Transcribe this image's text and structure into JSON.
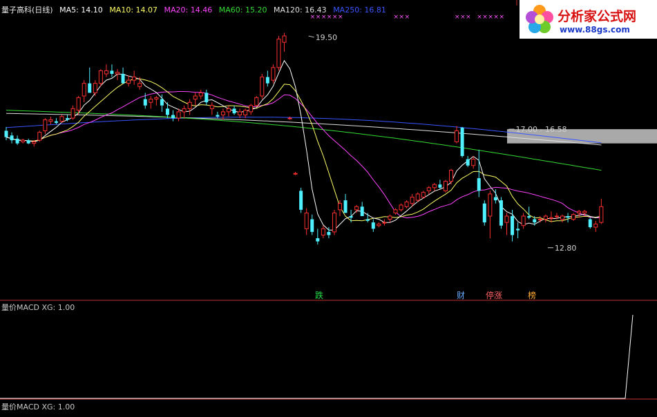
{
  "header": {
    "title": "量子高科(日线)",
    "indicators": [
      {
        "label": "MA5: 14.10",
        "color": "#ffffff"
      },
      {
        "label": "MA10: 14.07",
        "color": "#ffff66"
      },
      {
        "label": "MA20: 14.46",
        "color": "#ff44ff"
      },
      {
        "label": "MA60: 15.20",
        "color": "#33dd33"
      },
      {
        "label": "MA120: 16.43",
        "color": "#e0e0e0"
      },
      {
        "label": "MA250: 16.81",
        "color": "#3a55ff"
      }
    ]
  },
  "sub_panel": {
    "label_top": "量价MACD XG: 1.00",
    "label_bottom": "量价MACD XG: 1.00"
  },
  "logo": {
    "name": "分析家公式网",
    "url": "www.88gs.com"
  },
  "chart_data": {
    "type": "candlestick",
    "price_range": [
      11.9,
      20.2
    ],
    "colors": {
      "up": "#ff3030",
      "down": "#4ff0ff",
      "ma5": "#ffffff",
      "ma10": "#ffff66",
      "ma20": "#ff44ff",
      "ma60": "#33dd33",
      "ma120": "#e0e0e0",
      "ma250": "#3a55ff"
    },
    "annotations": [
      {
        "text": "19.50",
        "price": 19.5
      },
      {
        "text": "17.00 - 16.58",
        "price": 16.55
      },
      {
        "text": "12.80",
        "price": 12.8
      }
    ],
    "resistance_band": {
      "high": 16.55,
      "low": 16.1
    },
    "event_labels": [
      {
        "text": "跌",
        "color": "#22dd44"
      },
      {
        "text": "财",
        "color": "#66aaff"
      },
      {
        "text": "停涨",
        "color": "#ff6060"
      },
      {
        "text": "榜",
        "color": "#ffaa33"
      }
    ],
    "marker_symbol": "×",
    "candles": [
      [
        16.5,
        16.62,
        16.2,
        16.3
      ],
      [
        16.35,
        16.45,
        16.1,
        16.2
      ],
      [
        16.25,
        16.35,
        16.05,
        16.1
      ],
      [
        16.15,
        16.25,
        16.1,
        16.2
      ],
      [
        16.2,
        16.25,
        16.08,
        16.1
      ],
      [
        16.1,
        16.2,
        16.0,
        16.15
      ],
      [
        16.2,
        16.5,
        16.15,
        16.45
      ],
      [
        16.5,
        16.9,
        16.4,
        16.85
      ],
      [
        16.8,
        16.95,
        16.7,
        16.85
      ],
      [
        16.8,
        16.9,
        16.7,
        16.75
      ],
      [
        16.8,
        17.0,
        16.75,
        16.95
      ],
      [
        16.9,
        17.0,
        16.8,
        16.85
      ],
      [
        16.9,
        17.3,
        16.85,
        17.2
      ],
      [
        17.15,
        17.6,
        17.0,
        17.55
      ],
      [
        17.6,
        18.1,
        17.4,
        18.0
      ],
      [
        18.0,
        18.5,
        17.8,
        17.7
      ],
      [
        17.7,
        18.1,
        17.6,
        18.0
      ],
      [
        18.0,
        18.45,
        17.9,
        18.4
      ],
      [
        18.3,
        18.6,
        18.2,
        18.4
      ],
      [
        18.4,
        18.6,
        18.2,
        18.3
      ],
      [
        18.3,
        18.45,
        18.1,
        18.35
      ],
      [
        18.3,
        18.5,
        18.2,
        18.0
      ],
      [
        18.0,
        18.25,
        17.9,
        18.1
      ],
      [
        18.1,
        18.4,
        17.95,
        18.2
      ],
      [
        17.9,
        18.2,
        17.8,
        18.0
      ],
      [
        17.5,
        17.7,
        17.2,
        17.3
      ],
      [
        17.4,
        17.6,
        17.2,
        17.5
      ],
      [
        17.5,
        17.6,
        17.3,
        17.55
      ],
      [
        17.5,
        17.65,
        17.1,
        17.3
      ],
      [
        17.2,
        17.4,
        16.9,
        17.0
      ],
      [
        17.0,
        17.15,
        16.8,
        16.9
      ],
      [
        16.9,
        17.2,
        16.8,
        17.1
      ],
      [
        17.1,
        17.3,
        16.9,
        17.2
      ],
      [
        17.2,
        17.5,
        17.0,
        17.4
      ],
      [
        17.5,
        17.7,
        17.3,
        17.6
      ],
      [
        17.6,
        17.8,
        17.5,
        17.7
      ],
      [
        17.7,
        17.8,
        17.3,
        17.4
      ],
      [
        17.2,
        17.4,
        17.0,
        17.3
      ],
      [
        17.0,
        17.1,
        16.9,
        16.95
      ],
      [
        17.0,
        17.2,
        16.85,
        17.1
      ],
      [
        17.1,
        17.3,
        16.95,
        17.2
      ],
      [
        17.2,
        17.3,
        17.0,
        17.05
      ],
      [
        17.0,
        17.2,
        16.9,
        17.1
      ],
      [
        17.0,
        17.2,
        16.9,
        17.15
      ],
      [
        17.1,
        17.35,
        17.0,
        17.3
      ],
      [
        17.3,
        17.6,
        17.25,
        17.55
      ],
      [
        17.6,
        18.3,
        17.5,
        18.2
      ],
      [
        18.2,
        18.4,
        17.9,
        18.0
      ],
      [
        18.1,
        18.6,
        18.0,
        18.5
      ],
      [
        18.5,
        19.5,
        18.4,
        19.4
      ],
      [
        19.3,
        19.6,
        19.0,
        19.5
      ],
      [
        16.9,
        16.95,
        16.85,
        16.9
      ],
      [
        15.15,
        15.2,
        15.1,
        15.15
      ],
      [
        14.6,
        14.7,
        13.9,
        14.0
      ],
      [
        13.4,
        14.05,
        13.2,
        13.9
      ],
      [
        13.7,
        13.85,
        13.2,
        13.3
      ],
      [
        13.1,
        13.4,
        12.9,
        13.0
      ],
      [
        13.2,
        13.5,
        13.1,
        13.4
      ],
      [
        13.3,
        13.45,
        13.1,
        13.2
      ],
      [
        13.3,
        14.0,
        13.2,
        13.9
      ],
      [
        14.0,
        14.3,
        13.8,
        14.2
      ],
      [
        14.3,
        14.5,
        14.1,
        13.9
      ],
      [
        13.8,
        14.0,
        13.6,
        13.75
      ],
      [
        14.0,
        14.15,
        13.9,
        14.1
      ],
      [
        14.1,
        14.25,
        13.9,
        13.8
      ],
      [
        13.7,
        13.9,
        13.6,
        13.65
      ],
      [
        13.6,
        13.7,
        13.3,
        13.4
      ],
      [
        13.5,
        13.6,
        13.45,
        13.55
      ],
      [
        13.6,
        13.7,
        13.5,
        13.6
      ],
      [
        13.7,
        13.85,
        13.6,
        13.8
      ],
      [
        13.9,
        14.05,
        13.85,
        14.0
      ],
      [
        14.0,
        14.2,
        13.95,
        14.15
      ],
      [
        14.1,
        14.3,
        14.05,
        14.25
      ],
      [
        14.2,
        14.5,
        14.1,
        14.4
      ],
      [
        14.3,
        14.55,
        14.25,
        14.5
      ],
      [
        14.4,
        14.6,
        14.35,
        14.55
      ],
      [
        14.6,
        14.75,
        14.5,
        14.7
      ],
      [
        14.7,
        14.85,
        14.6,
        14.8
      ],
      [
        14.8,
        14.95,
        14.65,
        14.7
      ],
      [
        14.6,
        14.95,
        14.55,
        14.9
      ],
      [
        14.9,
        15.3,
        14.8,
        15.25
      ],
      [
        16.15,
        16.65,
        16.1,
        16.5
      ],
      [
        16.6,
        16.62,
        15.65,
        15.7
      ],
      [
        15.6,
        15.7,
        15.35,
        15.4
      ],
      [
        15.4,
        15.7,
        15.3,
        15.6
      ],
      [
        15.0,
        15.9,
        14.4,
        14.6
      ],
      [
        14.2,
        14.3,
        13.5,
        13.6
      ],
      [
        13.8,
        14.6,
        13.1,
        14.5
      ],
      [
        14.4,
        14.65,
        14.2,
        14.3
      ],
      [
        14.3,
        14.4,
        13.4,
        13.5
      ],
      [
        13.6,
        13.9,
        13.2,
        13.8
      ],
      [
        13.8,
        14.0,
        13.0,
        13.2
      ],
      [
        13.4,
        13.6,
        13.1,
        13.35
      ],
      [
        13.5,
        13.9,
        13.4,
        13.8
      ],
      [
        13.8,
        14.1,
        13.7,
        13.75
      ],
      [
        13.7,
        13.8,
        13.5,
        13.6
      ],
      [
        13.7,
        13.8,
        13.6,
        13.7
      ],
      [
        13.7,
        13.85,
        13.6,
        13.8
      ],
      [
        13.75,
        13.95,
        13.6,
        13.75
      ],
      [
        13.8,
        13.9,
        13.7,
        13.8
      ],
      [
        13.7,
        13.85,
        13.6,
        13.8
      ],
      [
        13.8,
        13.9,
        13.6,
        13.75
      ],
      [
        13.7,
        13.9,
        13.65,
        13.85
      ],
      [
        13.9,
        14.0,
        13.75,
        13.95
      ],
      [
        13.9,
        14.0,
        13.8,
        13.95
      ],
      [
        13.7,
        13.75,
        13.4,
        13.45
      ],
      [
        13.45,
        13.65,
        13.3,
        13.55
      ],
      [
        13.6,
        14.35,
        13.55,
        14.1
      ]
    ]
  }
}
